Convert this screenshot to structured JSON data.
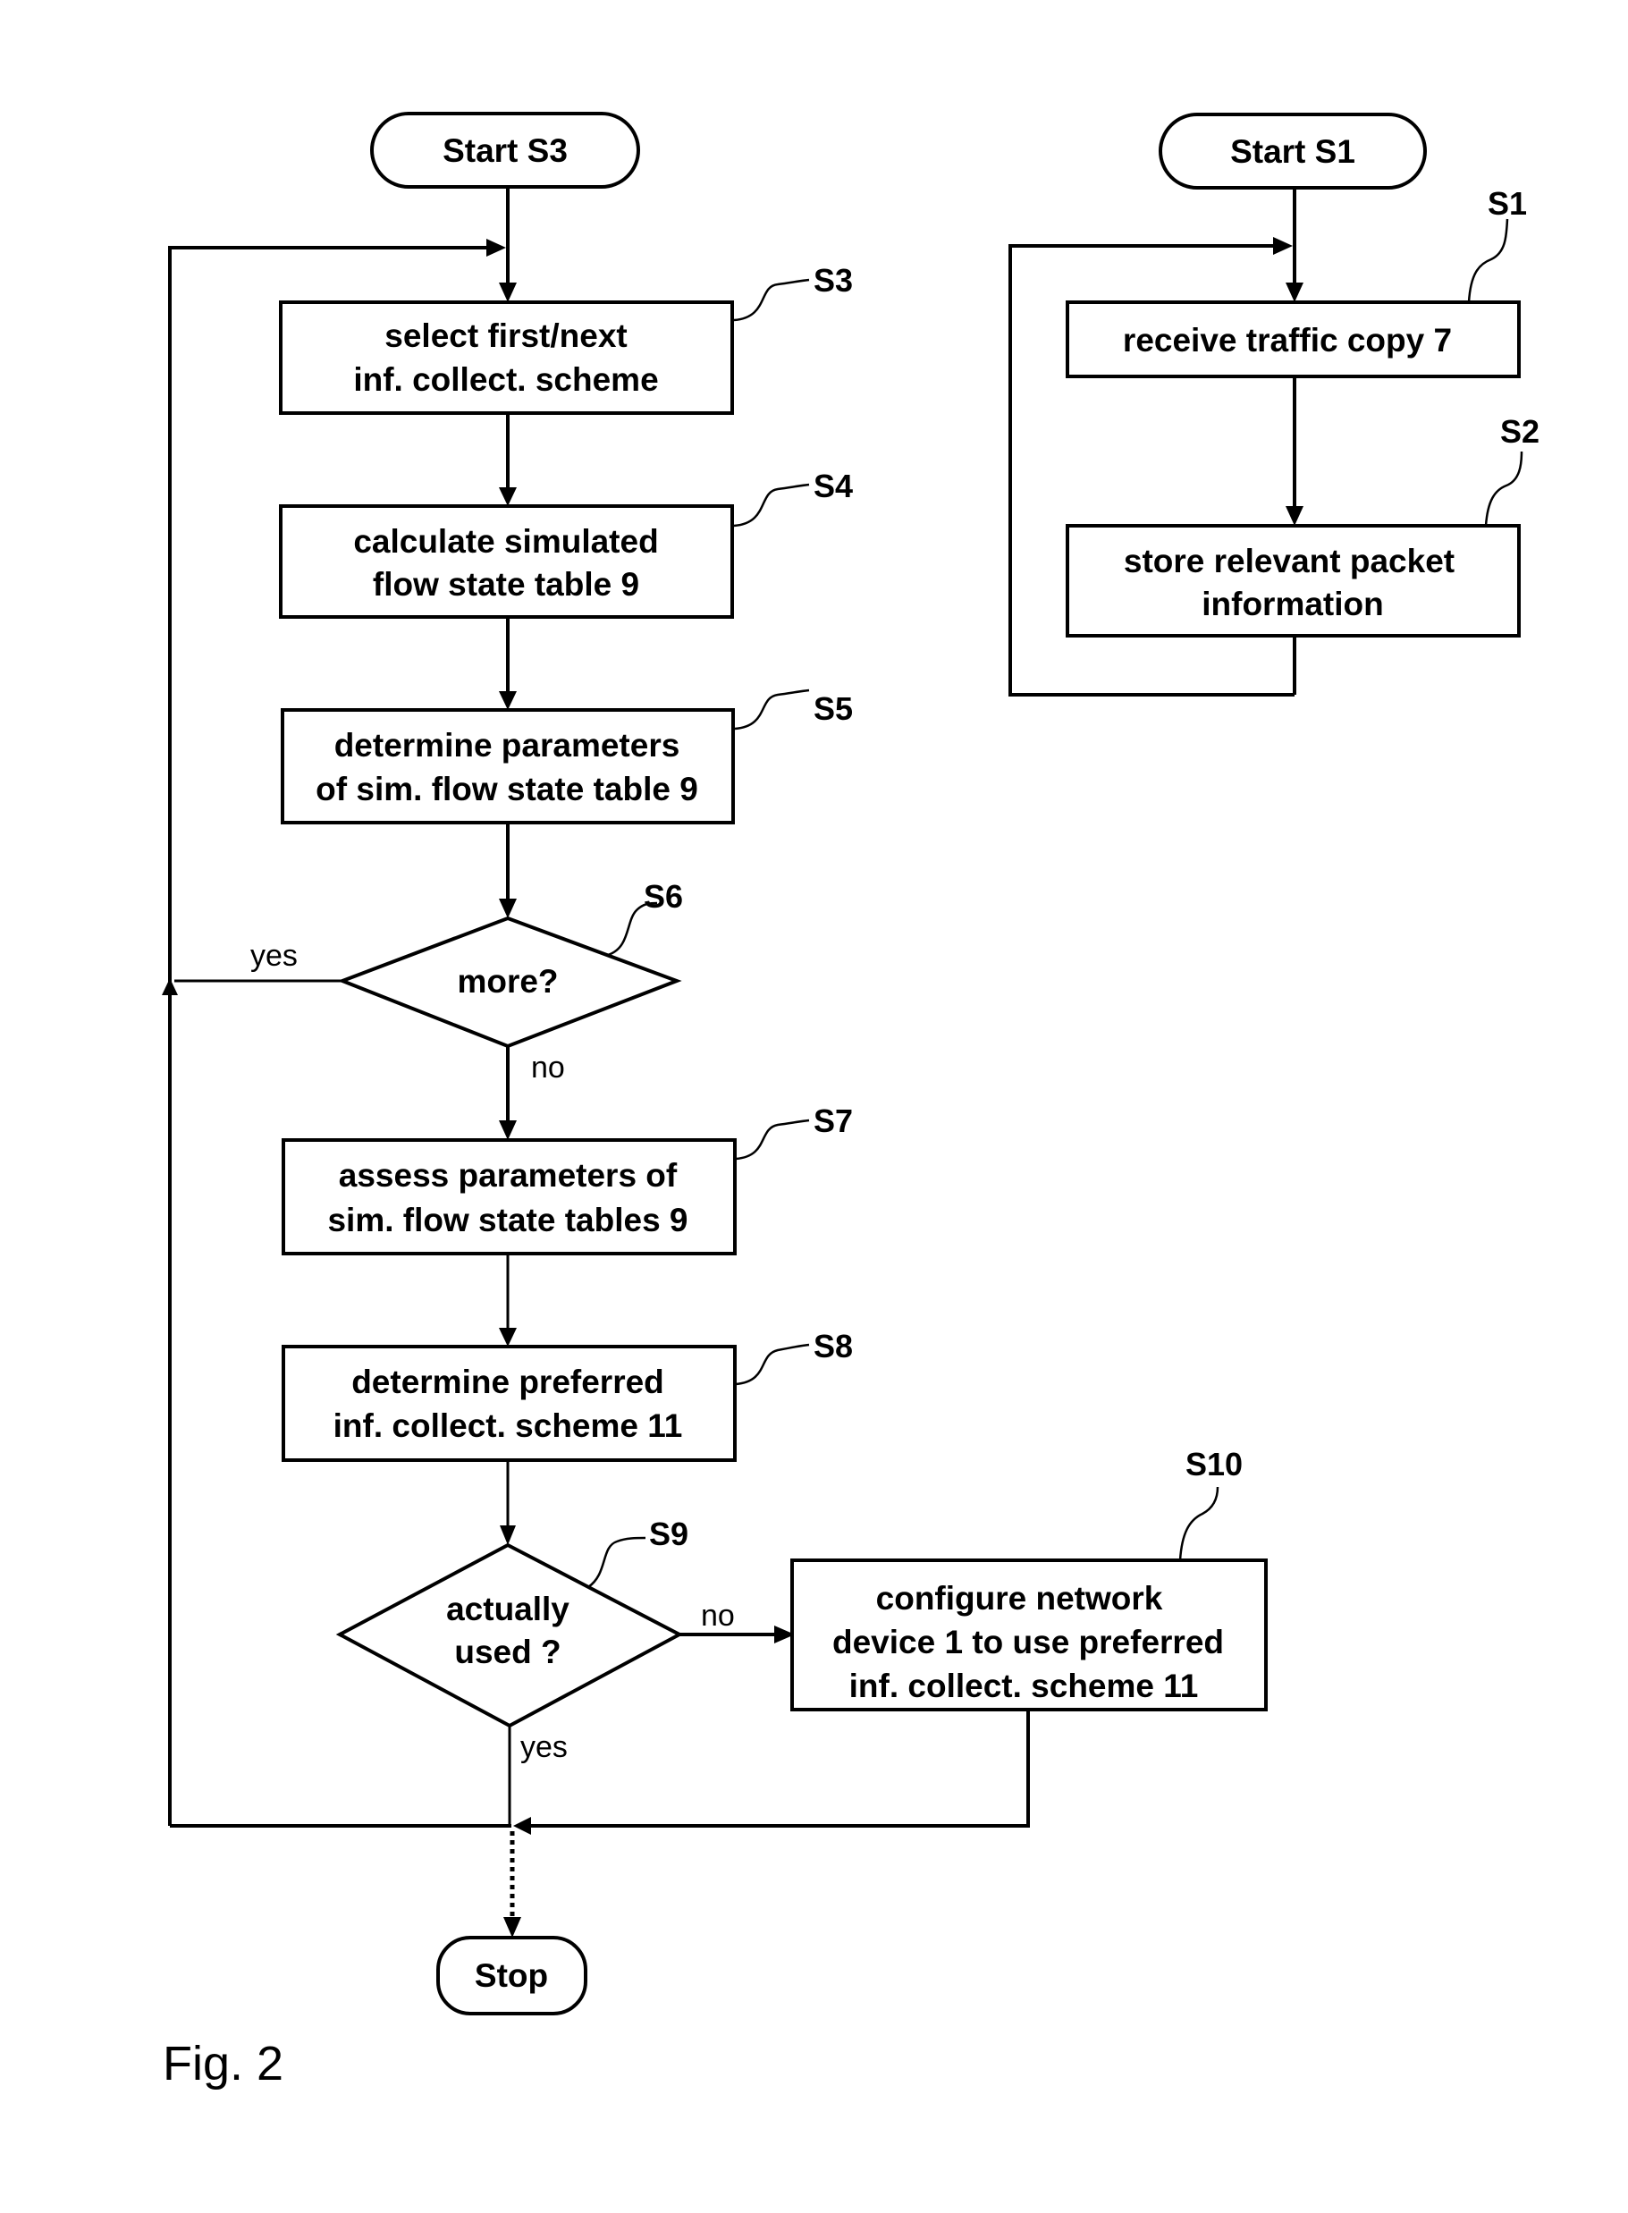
{
  "figure": {
    "caption": "Fig. 2"
  },
  "flow_left": {
    "start": "Start S3",
    "steps": [
      {
        "ref": "S3",
        "lines": [
          "select first/next",
          "inf. collect. scheme"
        ]
      },
      {
        "ref": "S4",
        "lines": [
          "calculate simulated",
          "flow state table 9"
        ]
      },
      {
        "ref": "S5",
        "lines": [
          "determine parameters",
          "of sim. flow state table 9"
        ]
      },
      {
        "ref": "S7",
        "lines": [
          "assess parameters of",
          "sim. flow state tables 9"
        ]
      },
      {
        "ref": "S8",
        "lines": [
          "determine preferred",
          "inf. collect. scheme 11"
        ]
      }
    ],
    "decision_s6": {
      "ref": "S6",
      "text": "more?",
      "yes": "yes",
      "no": "no"
    },
    "decision_s9": {
      "ref": "S9",
      "lines": [
        "actually",
        "used ?"
      ],
      "yes": "yes",
      "no": "no"
    },
    "step_s10": {
      "ref": "S10",
      "lines": [
        "configure network",
        "device 1 to use  preferred",
        "inf. collect. scheme 11"
      ]
    },
    "stop": "Stop"
  },
  "flow_right": {
    "start": "Start S1",
    "steps": [
      {
        "ref": "S1",
        "lines": [
          "receive traffic copy 7"
        ]
      },
      {
        "ref": "S2",
        "lines": [
          "store relevant packet",
          "information"
        ]
      }
    ]
  }
}
